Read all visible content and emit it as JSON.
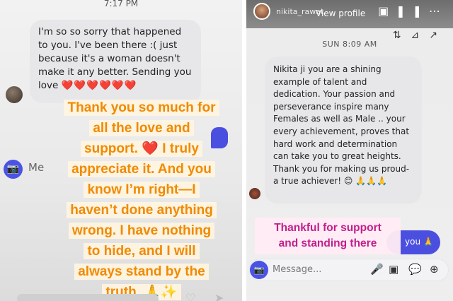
{
  "left": {
    "status_time": "7:17 PM",
    "bubble_text": "I'm so so sorry that happened to you. I've been there :( just because it's a woman doesn't make it any better. Sending you love",
    "bubble_hearts": "❤️❤️❤️❤️❤️❤️",
    "overlay_lines": [
      "Thank you so much for",
      "all the love and",
      "support. ❤️ I truly",
      "appreciate it. And you",
      "know I’m right—I",
      "haven’t done anything",
      "wrong. I have nothing",
      "to hide, and I will",
      "always stand by the",
      "truth. 🙏✨"
    ],
    "message_placeholder": "Me"
  },
  "right": {
    "username": "nikita_rawat",
    "view_profile": "View profile",
    "timestamp": "SUN 8:09 AM",
    "bubble_text": "Nikita ji you are  a shining example of talent and dedication. Your  passion and perseverance inspire many Females as well as Male .. your every achievement, proves that hard work and determination can take you to great heights. Thank you for making us proud- a true achiever! 😊 🙏🙏🙏",
    "sent_text": "you 🙏",
    "overlay_lines": [
      "Thankful for support",
      "and standing there"
    ],
    "message_placeholder": "Message..."
  },
  "colors": {
    "accent": "#4b4fe0",
    "overlay_orange": "#f08a00",
    "overlay_pink": "#c21e8c",
    "heart": "#e01b24"
  }
}
